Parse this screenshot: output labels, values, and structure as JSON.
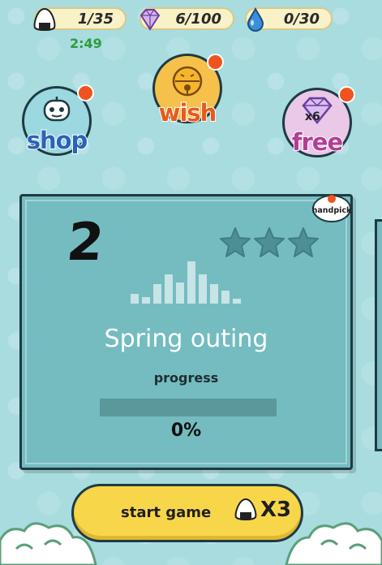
{
  "resources": {
    "rice_balls": "1/35",
    "gems": "6/100",
    "drops": "0/30",
    "timer": "2:49"
  },
  "menu": {
    "shop_label": "shop",
    "wish_label": "wish",
    "free_label": "free",
    "free_gem_badge": "x6"
  },
  "level_card": {
    "level_number": "2",
    "badge_label": "handpick",
    "stars_earned": 0,
    "stars_total": 3,
    "title": "Spring outing",
    "progress_label": "progress",
    "progress_value": 0,
    "progress_text": "0%"
  },
  "start": {
    "label": "start game",
    "cost_text": "X3"
  },
  "colors": {
    "background": "#a8dcdf",
    "card": "#74bcc0",
    "button": "#f8d64a",
    "badge": "#f0531f"
  }
}
